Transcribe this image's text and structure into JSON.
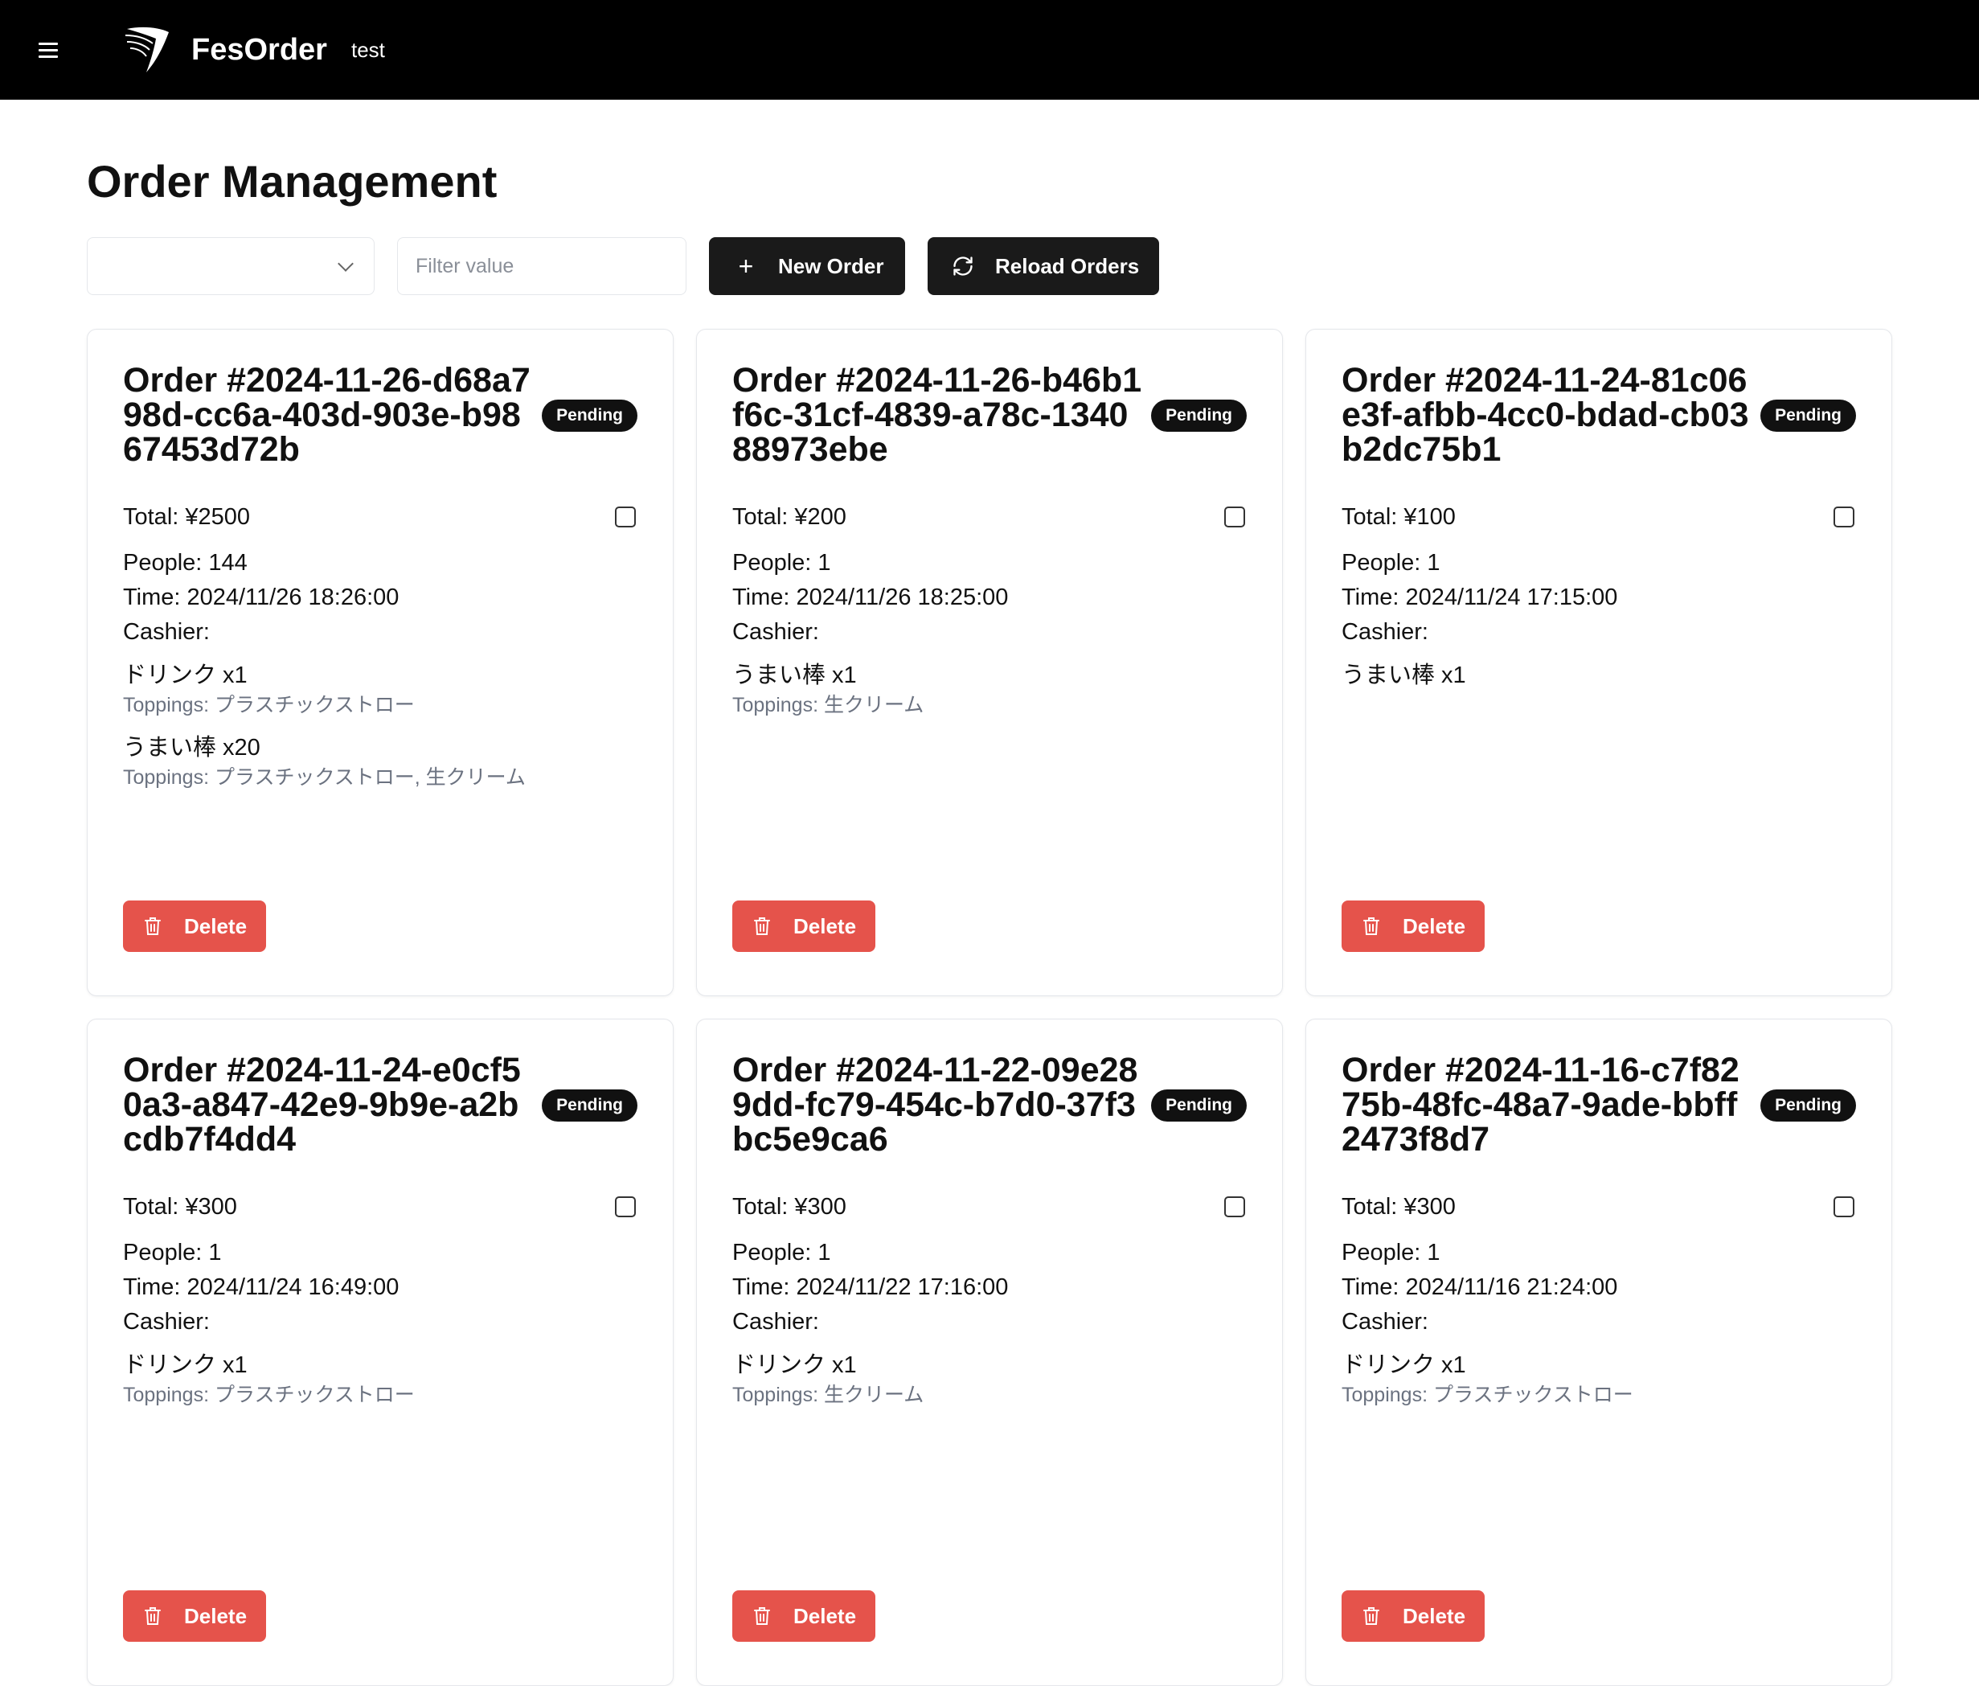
{
  "header": {
    "brand": "FesOrder",
    "env": "test"
  },
  "page": {
    "title": "Order Management"
  },
  "toolbar": {
    "filter_select_value": "",
    "filter_placeholder": "Filter value",
    "new_order_label": "New Order",
    "reload_label": "Reload Orders"
  },
  "orders": [
    {
      "title": "Order #2024-11-26-d68a798d-cc6a-403d-903e-b9867453d72b",
      "status": "Pending",
      "total": "Total: ¥2500",
      "people": "People: 144",
      "time": "Time: 2024/11/26 18:26:00",
      "cashier": "Cashier:",
      "items": [
        {
          "name": "ドリンク x1",
          "toppings": "Toppings: プラスチックストロー"
        },
        {
          "name": "うまい棒 x20",
          "toppings": "Toppings: プラスチックストロー, 生クリーム"
        }
      ],
      "delete_label": "Delete"
    },
    {
      "title": "Order #2024-11-26-b46b1f6c-31cf-4839-a78c-134088973ebe",
      "status": "Pending",
      "total": "Total: ¥200",
      "people": "People: 1",
      "time": "Time: 2024/11/26 18:25:00",
      "cashier": "Cashier:",
      "items": [
        {
          "name": "うまい棒 x1",
          "toppings": "Toppings: 生クリーム"
        }
      ],
      "delete_label": "Delete"
    },
    {
      "title": "Order #2024-11-24-81c06e3f-afbb-4cc0-bdad-cb03b2dc75b1",
      "status": "Pending",
      "total": "Total: ¥100",
      "people": "People: 1",
      "time": "Time: 2024/11/24 17:15:00",
      "cashier": "Cashier:",
      "items": [
        {
          "name": "うまい棒 x1",
          "toppings": ""
        }
      ],
      "delete_label": "Delete"
    },
    {
      "title": "Order #2024-11-24-e0cf50a3-a847-42e9-9b9e-a2bcdb7f4dd4",
      "status": "Pending",
      "total": "Total: ¥300",
      "people": "People: 1",
      "time": "Time: 2024/11/24 16:49:00",
      "cashier": "Cashier:",
      "items": [
        {
          "name": "ドリンク x1",
          "toppings": "Toppings: プラスチックストロー"
        }
      ],
      "delete_label": "Delete"
    },
    {
      "title": "Order #2024-11-22-09e289dd-fc79-454c-b7d0-37f3bc5e9ca6",
      "status": "Pending",
      "total": "Total: ¥300",
      "people": "People: 1",
      "time": "Time: 2024/11/22 17:16:00",
      "cashier": "Cashier:",
      "items": [
        {
          "name": "ドリンク x1",
          "toppings": "Toppings: 生クリーム"
        }
      ],
      "delete_label": "Delete"
    },
    {
      "title": "Order #2024-11-16-c7f8275b-48fc-48a7-9ade-bbff2473f8d7",
      "status": "Pending",
      "total": "Total: ¥300",
      "people": "People: 1",
      "time": "Time: 2024/11/16 21:24:00",
      "cashier": "Cashier:",
      "items": [
        {
          "name": "ドリンク x1",
          "toppings": "Toppings: プラスチックストロー"
        }
      ],
      "delete_label": "Delete"
    }
  ],
  "icons": {
    "menu": "hamburger-menu-icon",
    "logo": "fesorder-logo",
    "chevron": "chevron-down-icon",
    "plus": "plus-icon",
    "reload": "reload-icon",
    "trash": "trash-icon"
  },
  "colors": {
    "header_bg": "#000000",
    "primary_button": "#1a1a1a",
    "delete_button": "#e5534b",
    "badge_bg": "#111111",
    "muted_text": "#6b7280"
  }
}
